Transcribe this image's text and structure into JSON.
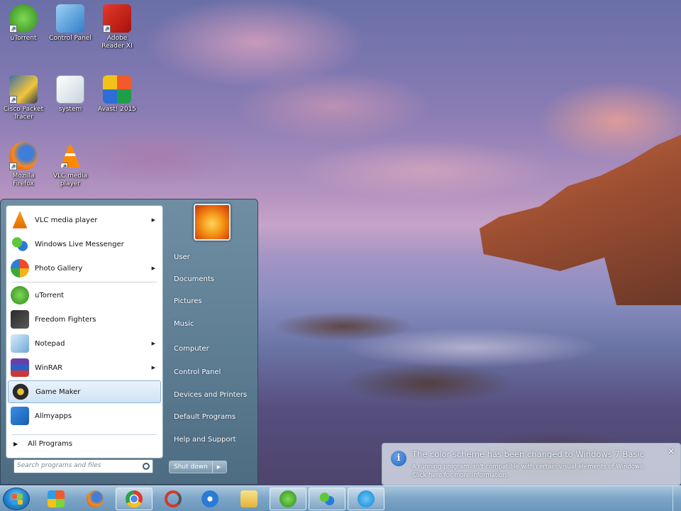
{
  "desktop": {
    "icons": [
      {
        "label": "uTorrent",
        "icon": "utorrent-icon"
      },
      {
        "label": "Control Panel",
        "icon": "control-panel-icon"
      },
      {
        "label": "Adobe Reader XI",
        "icon": "adobe-reader-icon"
      },
      {
        "label": "Cisco Packet Tracer",
        "icon": "cisco-packet-tracer-icon"
      },
      {
        "label": "system",
        "icon": "system-file-icon"
      },
      {
        "label": "Avast! 2015",
        "icon": "avast-icon"
      },
      {
        "label": "Mozilla Firefox",
        "icon": "firefox-icon"
      },
      {
        "label": "VLC media player",
        "icon": "vlc-icon"
      }
    ]
  },
  "start_menu": {
    "programs": [
      {
        "label": "VLC media player",
        "icon": "vlc-icon",
        "has_submenu": true
      },
      {
        "label": "Windows Live Messenger",
        "icon": "messenger-icon",
        "has_submenu": false
      },
      {
        "label": "Photo Gallery",
        "icon": "photo-gallery-icon",
        "has_submenu": true
      },
      {
        "label": "uTorrent",
        "icon": "utorrent-icon",
        "has_submenu": false
      },
      {
        "label": "Freedom Fighters",
        "icon": "freedom-fighters-icon",
        "has_submenu": false
      },
      {
        "label": "Notepad",
        "icon": "notepad-icon",
        "has_submenu": true
      },
      {
        "label": "WinRAR",
        "icon": "winrar-icon",
        "has_submenu": true
      },
      {
        "label": "Game Maker",
        "icon": "game-maker-icon",
        "has_submenu": false,
        "highlighted": true
      },
      {
        "label": "Allmyapps",
        "icon": "allmyapps-icon",
        "has_submenu": false
      }
    ],
    "all_programs_label": "All Programs",
    "search_placeholder": "Search programs and files",
    "right_items": [
      "User",
      "Documents",
      "Pictures",
      "Music",
      "Computer",
      "Control Panel",
      "Devices and Printers",
      "Default Programs",
      "Help and Support"
    ],
    "shutdown_label": "Shut down"
  },
  "notification": {
    "title": "The color scheme has been changed to Windows 7 Basic",
    "line1": "A running program isn't compatible with certain visual elements of Windows.",
    "line2": "Click here for more information."
  },
  "taskbar": {
    "items": [
      {
        "icon": "windows-explorer-game-icon",
        "state": "pinned"
      },
      {
        "icon": "firefox-icon",
        "state": "pinned"
      },
      {
        "icon": "chrome-icon",
        "state": "running"
      },
      {
        "icon": "app-refresh-icon",
        "state": "pinned"
      },
      {
        "icon": "thunder-icon",
        "state": "pinned"
      },
      {
        "icon": "folder-icon",
        "state": "pinned"
      },
      {
        "icon": "utorrent-icon",
        "state": "running"
      },
      {
        "icon": "messenger-icon",
        "state": "running"
      },
      {
        "icon": "skype-icon",
        "state": "running"
      }
    ]
  },
  "colors": {
    "taskbar": "#7ea7c8",
    "start_menu": "#5f7f95",
    "highlight": "#cfe3f5"
  }
}
